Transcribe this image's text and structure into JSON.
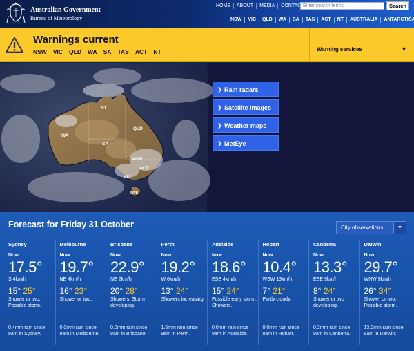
{
  "header": {
    "gov_title": "Australian Government",
    "bom_title": "Bureau of Meteorology",
    "top_nav": [
      "HOME",
      "ABOUT",
      "MEDIA",
      "CONTACTS"
    ],
    "search_placeholder": "Enter search terms",
    "search_button": "Search",
    "state_nav": [
      "NSW",
      "VIC",
      "QLD",
      "WA",
      "SA",
      "TAS",
      "ACT",
      "NT",
      "AUSTRALIA",
      "ANTARCTICA"
    ]
  },
  "warnings": {
    "title": "Warnings current",
    "states": [
      "NSW",
      "VIC",
      "QLD",
      "WA",
      "SA",
      "TAS",
      "ACT",
      "NT"
    ],
    "services_label": "Warning services",
    "icon": "warning-triangle-icon"
  },
  "map": {
    "labels": [
      "NT",
      "QLD",
      "WA",
      "SA",
      "NSW",
      "ACT",
      "VIC",
      "TAS"
    ]
  },
  "quick_links": [
    "Rain radars",
    "Satellite images",
    "Weather maps",
    "MetEye"
  ],
  "forecast": {
    "title": "Forecast for Friday 31 October",
    "select_value": "City observations",
    "now_label": "Now",
    "cities": [
      {
        "name": "Sydney",
        "temp": "17.5°",
        "wind": "S 4km/h",
        "min": "15°",
        "max": "25°",
        "desc": "Shower or two. Possible storm.",
        "rain": "0.4mm rain since 9am in Sydney."
      },
      {
        "name": "Melbourne",
        "temp": "19.7°",
        "wind": "NE 4km/h",
        "min": "16°",
        "max": "23°",
        "desc": "Shower or two.",
        "rain": "0.0mm rain since 9am in Melbourne."
      },
      {
        "name": "Brisbane",
        "temp": "22.9°",
        "wind": "NE 2km/h",
        "min": "20°",
        "max": "28°",
        "desc": "Showers. Storm developing.",
        "rain": "0.0mm rain since 9am in Brisbane."
      },
      {
        "name": "Perth",
        "temp": "19.2°",
        "wind": "W 6km/h",
        "min": "13°",
        "max": "24°",
        "desc": "Showers increasing.",
        "rain": "1.6mm rain since 9am in Perth."
      },
      {
        "name": "Adelaide",
        "temp": "18.6°",
        "wind": "ESE 4km/h",
        "min": "15°",
        "max": "24°",
        "desc": "Possible early storm. Showers.",
        "rain": "0.0mm rain since 9am in Adelaide."
      },
      {
        "name": "Hobart",
        "temp": "10.4°",
        "wind": "WSW 13km/h",
        "min": "7°",
        "max": "21°",
        "desc": "Partly cloudy.",
        "rain": "0.0mm rain since 9am in Hobart."
      },
      {
        "name": "Canberra",
        "temp": "13.3°",
        "wind": "ESE 9km/h",
        "min": "8°",
        "max": "24°",
        "desc": "Shower or two developing.",
        "rain": "0.2mm rain since 9am in Canberra."
      },
      {
        "name": "Darwin",
        "temp": "29.7°",
        "wind": "WNW 9km/h",
        "min": "26°",
        "max": "34°",
        "desc": "Shower or two. Possible storm.",
        "rain": "13.0mm rain since 9am in Darwin."
      }
    ]
  },
  "colors": {
    "warning_yellow": "#fbc92b",
    "link_blue": "#2f62e6",
    "forecast_blue": "#1954ac",
    "max_temp_yellow": "#fbc92b"
  }
}
